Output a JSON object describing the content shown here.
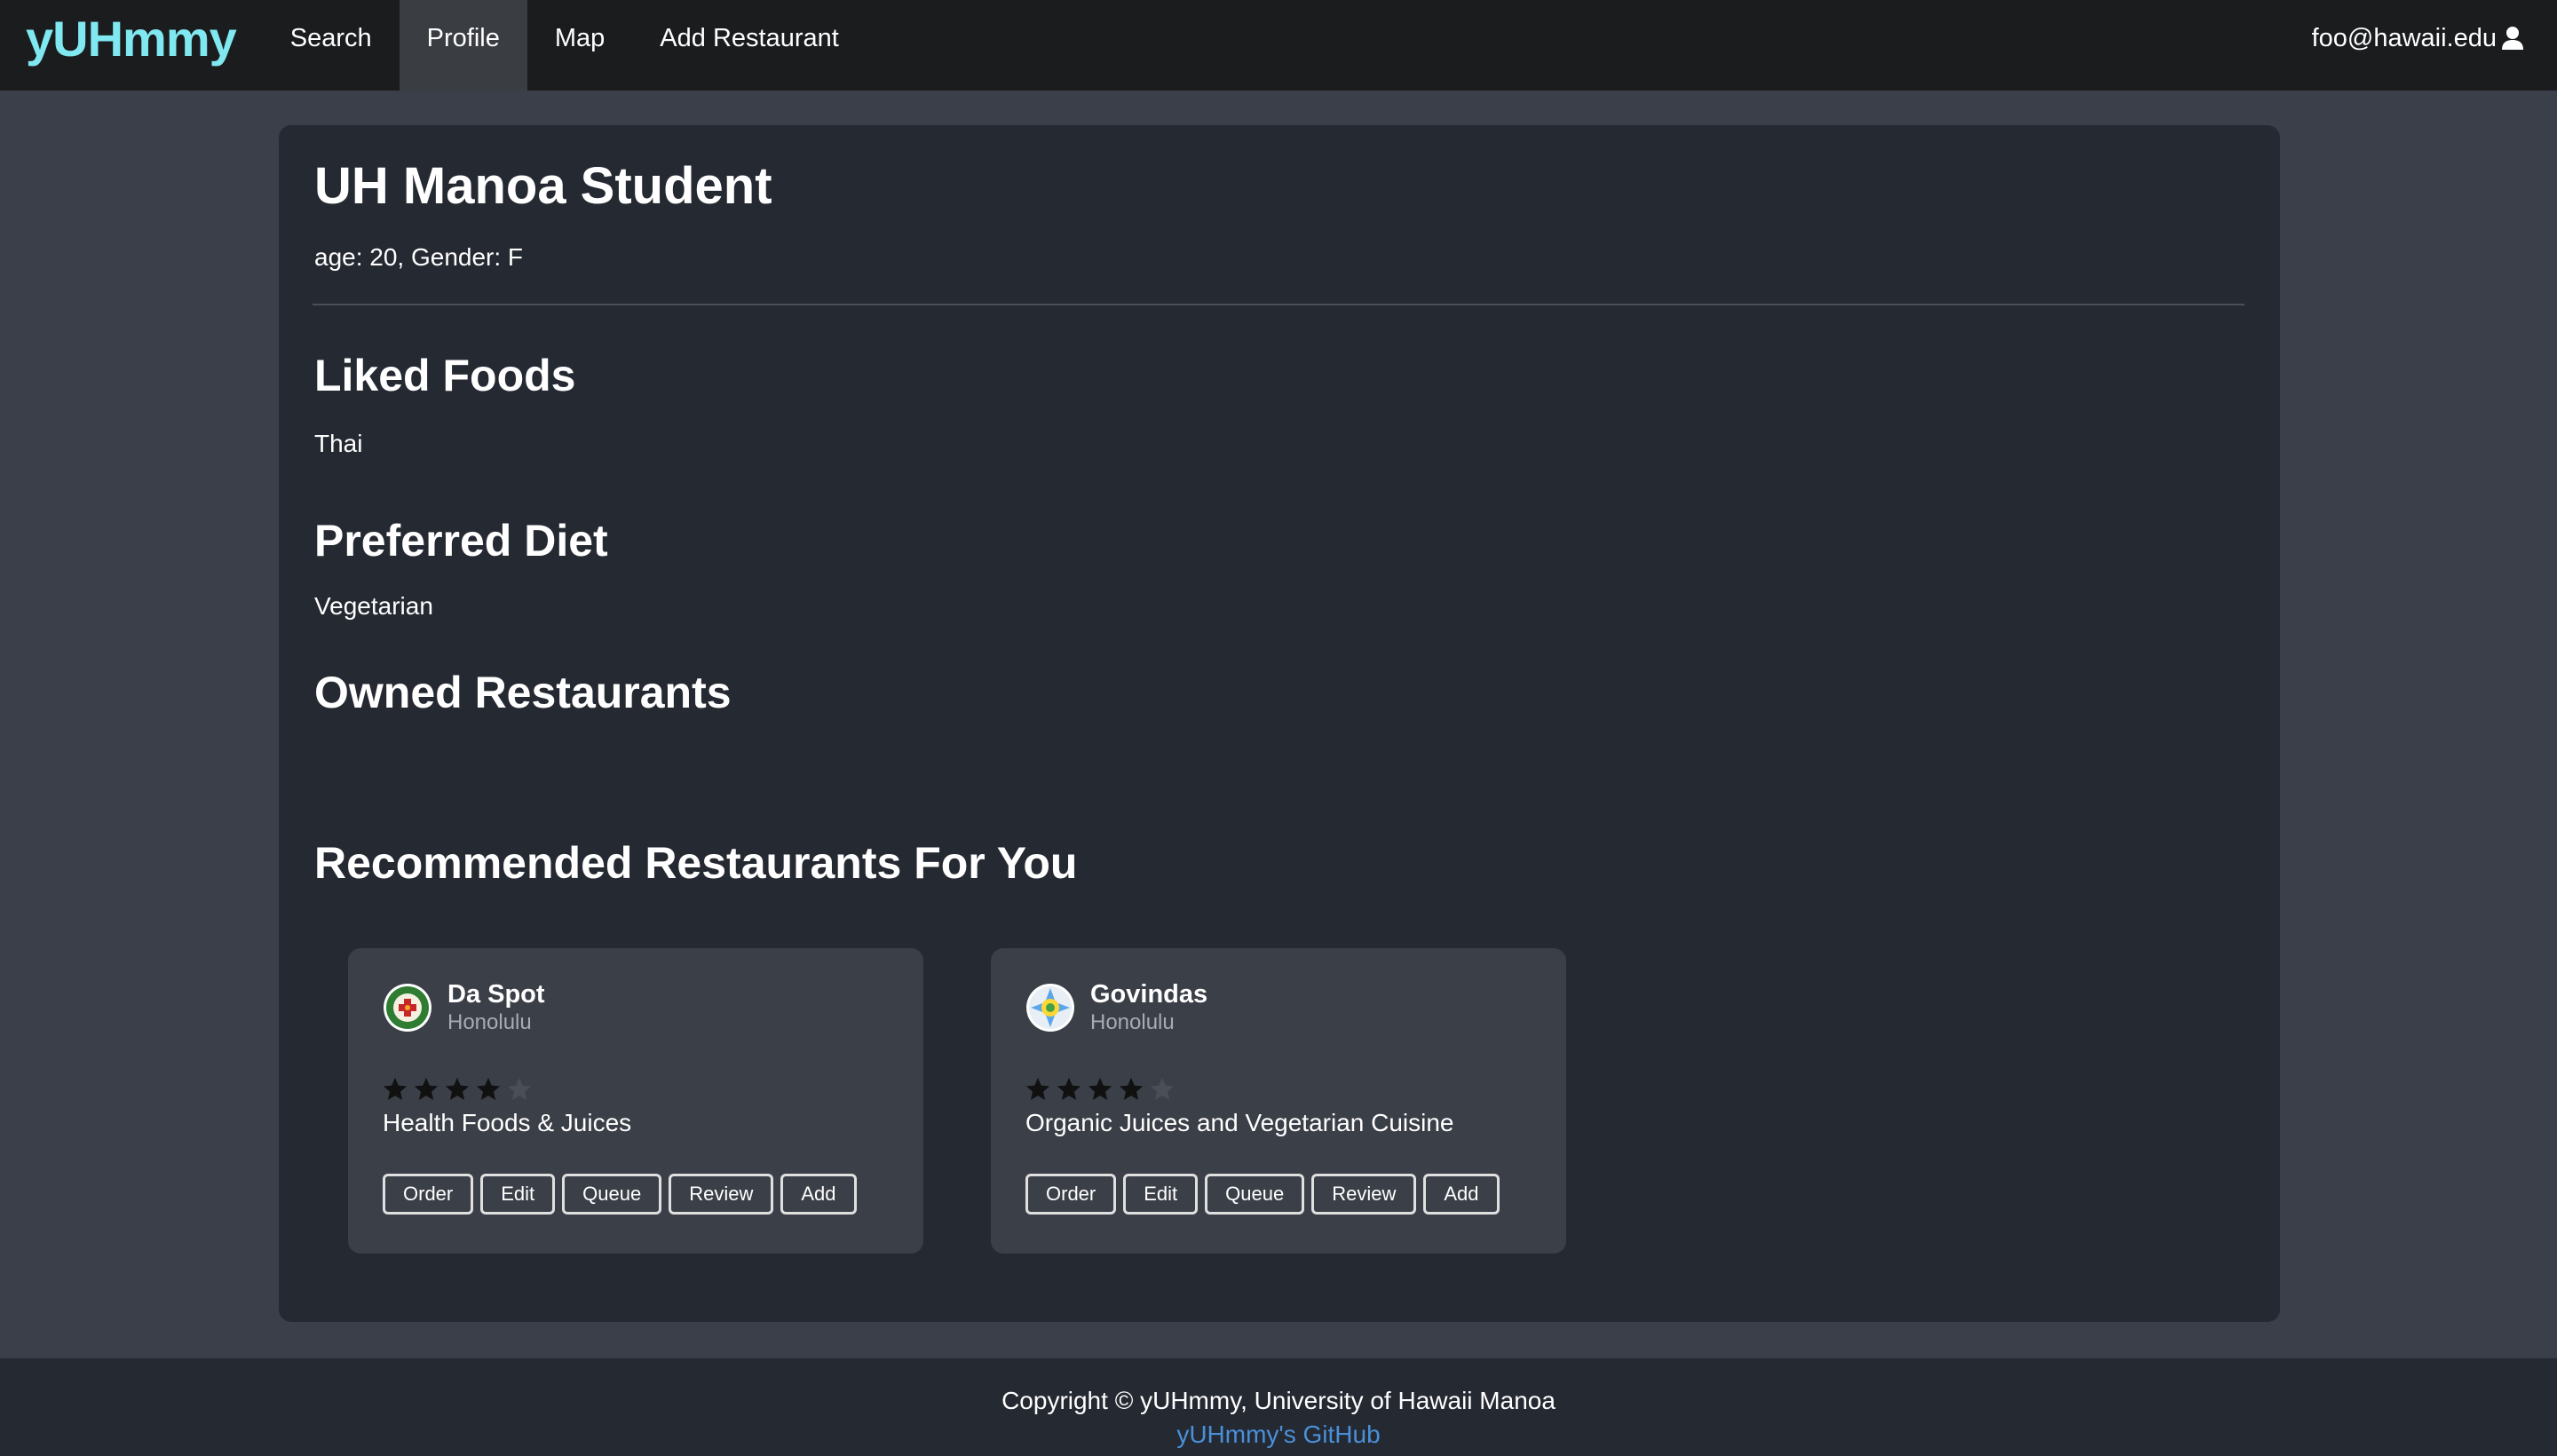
{
  "navbar": {
    "brand": "yUHmmy",
    "items": [
      {
        "label": "Search",
        "active": false
      },
      {
        "label": "Profile",
        "active": true
      },
      {
        "label": "Map",
        "active": false
      },
      {
        "label": "Add Restaurant",
        "active": false
      }
    ],
    "user_email": "foo@hawaii.edu",
    "user_icon": "user-icon"
  },
  "profile": {
    "name": "UH Manoa Student",
    "info": "age: 20, Gender: F"
  },
  "sections": {
    "liked_foods_heading": "Liked Foods",
    "liked_foods_value": "Thai",
    "preferred_diet_heading": "Preferred Diet",
    "preferred_diet_value": "Vegetarian",
    "owned_restaurants_heading": "Owned Restaurants",
    "recommended_heading": "Recommended Restaurants For You"
  },
  "restaurants": [
    {
      "name": "Da Spot",
      "city": "Honolulu",
      "rating": 4,
      "max_rating": 5,
      "description": "Health Foods & Juices",
      "logo_icon": "da-spot-logo",
      "buttons": [
        "Order",
        "Edit",
        "Queue",
        "Review",
        "Add"
      ]
    },
    {
      "name": "Govindas",
      "city": "Honolulu",
      "rating": 4,
      "max_rating": 5,
      "description": "Organic Juices and Vegetarian Cuisine",
      "logo_icon": "govindas-logo",
      "buttons": [
        "Order",
        "Edit",
        "Queue",
        "Review",
        "Add"
      ]
    }
  ],
  "footer": {
    "copyright": "Copyright © yUHmmy, University of Hawaii Manoa",
    "github_link": "yUHmmy's GitHub"
  },
  "colors": {
    "brand": "#7fe8f0",
    "navbar_bg": "#1b1c1e",
    "page_bg": "#3a3f4a",
    "card_bg": "#252932",
    "rest_card_bg": "#3b3f48",
    "link": "#4a90d9",
    "star_filled": "#111111",
    "star_empty": "#4a4e57"
  }
}
